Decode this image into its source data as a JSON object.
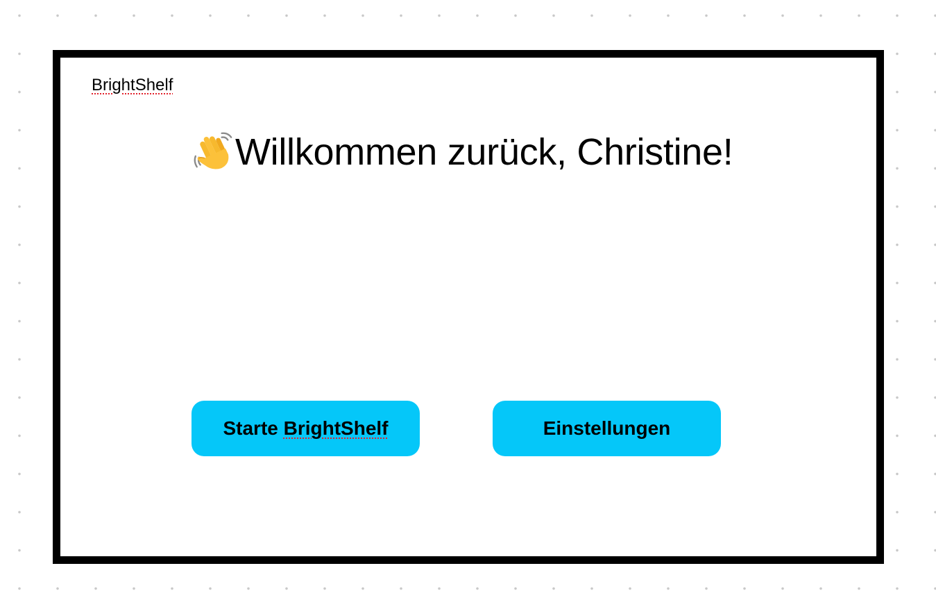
{
  "app": {
    "brand": "BrightShelf"
  },
  "welcome": {
    "icon": "waving-hand-icon",
    "text": "Willkommen zurück, Christine!"
  },
  "buttons": {
    "start_prefix": "Starte ",
    "start_brand": "BrightShelf",
    "settings_label": "Einstellungen"
  },
  "colors": {
    "button_background": "#05c7f9",
    "frame_border": "#000000",
    "spellcheck_underline": "#e0202a",
    "canvas_dots": "#c9c9c9"
  }
}
